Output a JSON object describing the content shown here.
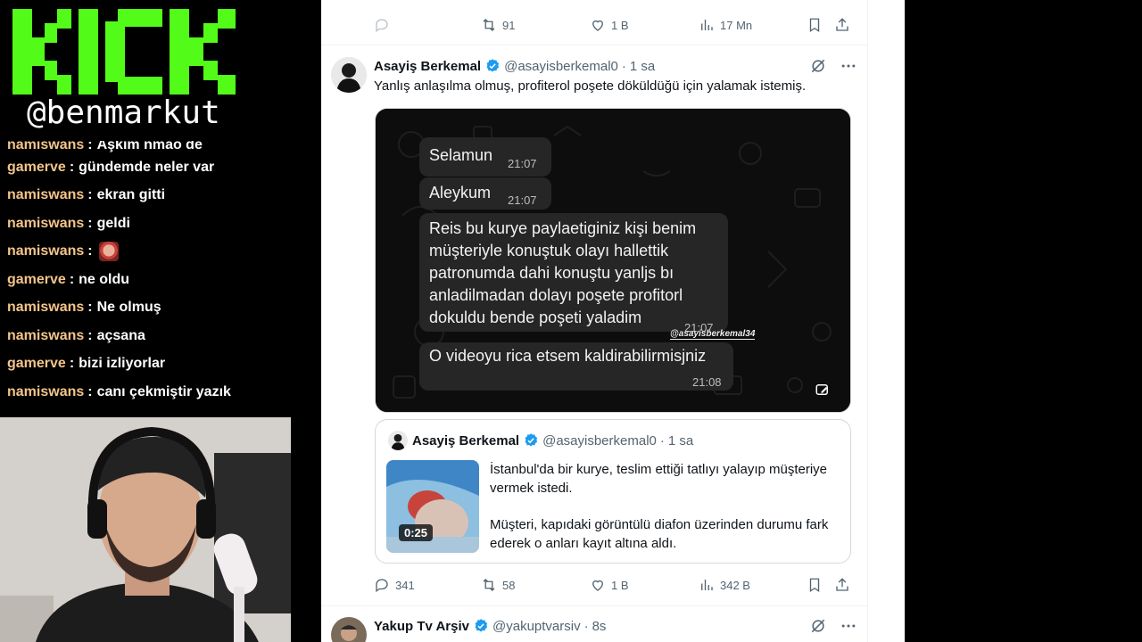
{
  "overlay": {
    "handle": "@benmarkut",
    "chat": [
      {
        "user": "namiswans",
        "message": "Aşkım nmao de",
        "emote": false
      },
      {
        "user": "gamerve",
        "message": "gündemde neler var",
        "emote": false
      },
      {
        "user": "namiswans",
        "message": "ekran gitti",
        "emote": false
      },
      {
        "user": "namiswans",
        "message": "geldi",
        "emote": false
      },
      {
        "user": "namiswans",
        "message": "",
        "emote": true
      },
      {
        "user": "gamerve",
        "message": "ne oldu",
        "emote": false
      },
      {
        "user": "namiswans",
        "message": "Ne olmuş",
        "emote": false
      },
      {
        "user": "namiswans",
        "message": "açsana",
        "emote": false
      },
      {
        "user": "gamerve",
        "message": "bizi izliyorlar",
        "emote": false
      },
      {
        "user": "namiswans",
        "message": "canı çekmiştir yazık",
        "emote": false
      }
    ],
    "brand_color": "#53fc18",
    "username_color": "#f4c48a"
  },
  "feed": {
    "prev_tweet_actions": {
      "replies": "",
      "retweets": "91",
      "likes": "1 B",
      "views": "17 Mn"
    },
    "tweet": {
      "author": "Asayiş Berkemal",
      "handle": "@asayisberkemal0",
      "time": "1 sa",
      "text": "Yanlış anlaşılma olmuş, profiterol poşete döküldüğü için yalamak istemiş.",
      "whatsapp": {
        "messages": [
          {
            "text": "Selamun",
            "time": "21:07"
          },
          {
            "text": "Aleykum",
            "time": "21:07"
          },
          {
            "text": "Reis bu kurye paylaetiginiz kişi benim\nmüşteriyle konuştuk olayı hallettik\npatronumda dahi konuştu yanljs bı\nanladilmadan dolayı poşete profitorl\ndokuldu bende poşeti yaladim",
            "time": "21:07"
          },
          {
            "text": "O videoyu rica etsem kaldirabilirmisjniz",
            "time": "21:08"
          }
        ],
        "watermark": "@asayisberkemal34"
      },
      "quote": {
        "author": "Asayiş Berkemal",
        "handle": "@asayisberkemal0",
        "time": "1 sa",
        "video_duration": "0:25",
        "text_1": "İstanbul'da bir kurye, teslim ettiği tatlıyı yalayıp müşteriye vermek istedi.",
        "text_2": "Müşteri, kapıdaki görüntülü diafon üzerinden durumu fark ederek o anları kayıt altına aldı."
      },
      "actions": {
        "replies": "341",
        "retweets": "58",
        "likes": "1 B",
        "views": "342 B"
      }
    },
    "next_tweet": {
      "author": "Yakup Tv Arşiv",
      "handle": "@yakuptvarsiv",
      "time": "8s"
    },
    "accent_color": "#1d9bf0"
  }
}
